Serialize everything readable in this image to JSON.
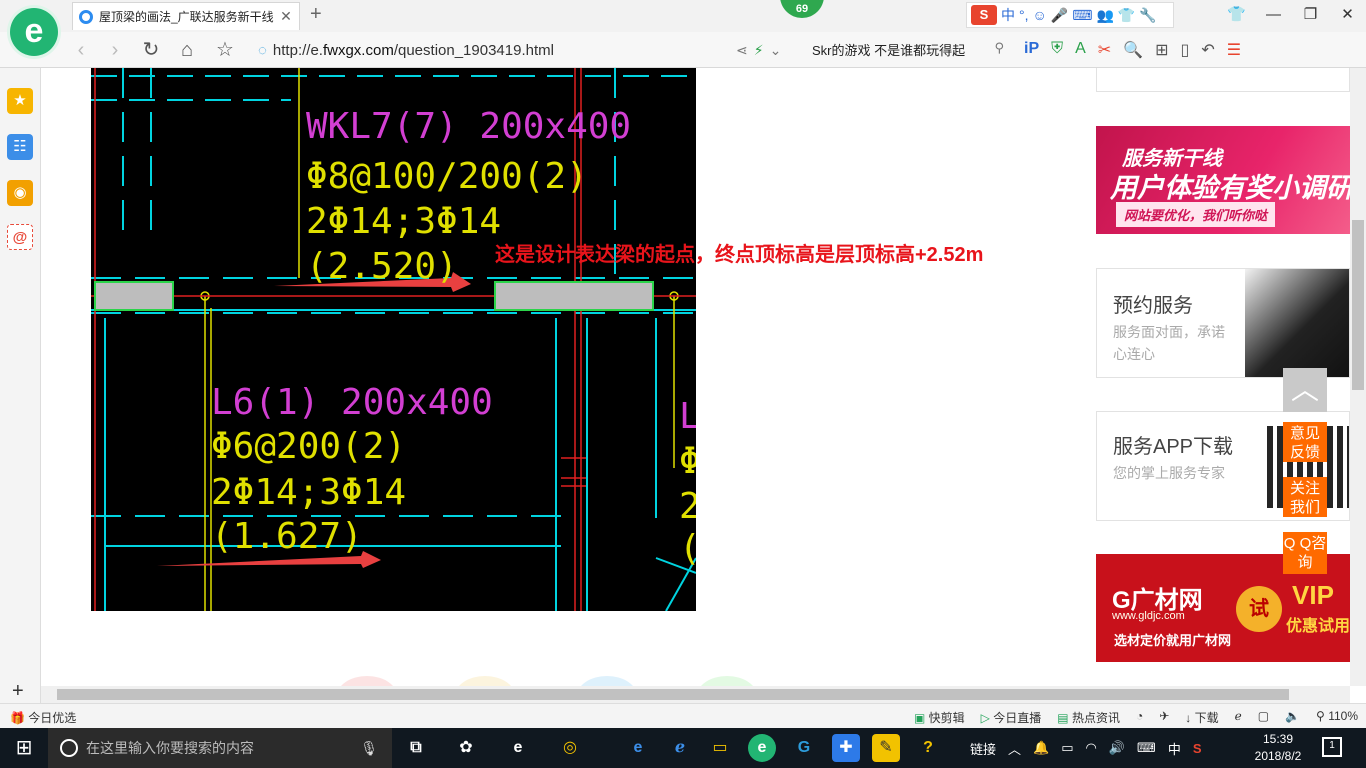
{
  "browser": {
    "tab_title": "屋顶梁的画法_广联达服务新干线",
    "new_tab": "+",
    "badge": "69",
    "ime": [
      "中",
      "°,",
      "☺",
      "🎤",
      "⌨",
      "👥",
      "👕",
      "🔧"
    ],
    "ime_logo": "S",
    "url_domain": "http://e.",
    "url_bold": "fwxgx.com",
    "url_path": "/question_1903419.html",
    "search_text": "Skr的游戏 不是谁都玩得起",
    "zoom": "110%"
  },
  "cad": {
    "beam1": {
      "name": "WKL7(7) 200x400",
      "stirrup": "Φ8@100/200(2)",
      "rebar": "2Φ14;3Φ14",
      "elevation": "(2.520)"
    },
    "beam2": {
      "name": "L6(1) 200x400",
      "stirrup": "Φ6@200(2)",
      "rebar": "2Φ14;3Φ14",
      "elevation": "(1.627)"
    },
    "edge_marks": [
      "L",
      "Φ",
      "2",
      "("
    ]
  },
  "annotation": {
    "text": "这是设计表达梁的起点，终点顶标高是层顶标高",
    "value": "+2.52m"
  },
  "ads": {
    "banner1": {
      "line1": "服务新干线",
      "line2": "用户体验有奖小调研",
      "line3": "网站要优化，我们听你哒"
    },
    "card1": {
      "title": "预约服务",
      "desc": "服务面对面，承诺心连心"
    },
    "card2": {
      "title": "服务APP下载",
      "desc": "您的掌上服务专家"
    },
    "banner2": {
      "brand": "G广材网",
      "url": "www.gldjc.com",
      "slogan": "选材定价就用广材网",
      "try": "试",
      "vip": "VIP",
      "vip_sub": "优惠试用"
    }
  },
  "floating": {
    "to_top": "︿",
    "feedback": "意见反馈",
    "follow": "关注我们",
    "qq": "Q Q咨询"
  },
  "statusbar": {
    "left": "今日优选",
    "items": [
      "快剪辑",
      "今日直播",
      "热点资讯",
      "下载"
    ]
  },
  "taskbar": {
    "search_placeholder": "在这里输入你要搜索的内容",
    "link_label": "链接",
    "ime_char": "中",
    "time": "15:39",
    "date": "2018/8/2",
    "notifications": "1"
  }
}
